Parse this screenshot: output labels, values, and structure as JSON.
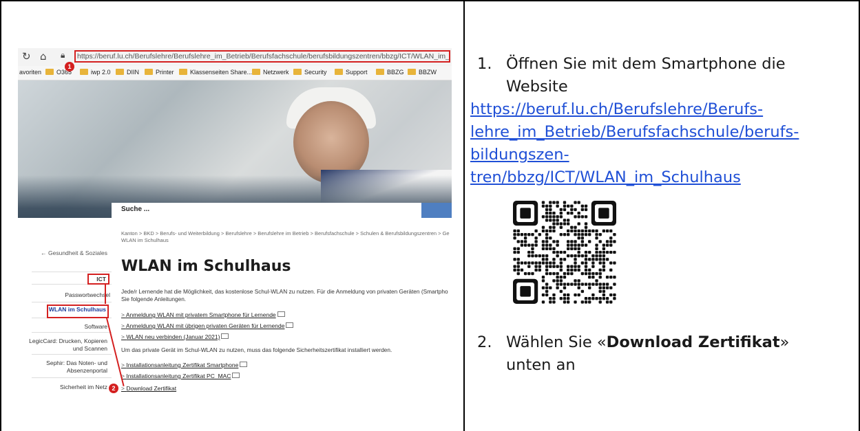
{
  "browser": {
    "reload_icon": "reload-icon",
    "home_icon": "home-icon",
    "url": "https://beruf.lu.ch/Berufslehre/Berufslehre_im_Betrieb/Berufsfachschule/berufsbildungszentren/bbzg/ICT/WLAN_im_Schulhaus"
  },
  "favorites": [
    "avoriten",
    "O365",
    "iwp 2.0",
    "DIIN",
    "Printer",
    "Klassenseiten Share...",
    "Netzwerk",
    "Security",
    "Support",
    "BBZG",
    "BBZW"
  ],
  "site": {
    "search_placeholder": "Suche ...",
    "breadcrumb": "Kanton  >  BKD  >  Berufs- und Weiterbildung  >  Berufslehre  >  Berufslehre im Betrieb  >  Berufsfachschule  >  Schulen & Berufsbildungszentren  >  Ge WLAN im Schulhaus",
    "back_link": "←  Gesundheit & Soziales",
    "nav_section": "ICT",
    "nav_items": [
      "Passwortwechsel",
      "WLAN im Schulhaus",
      "Software",
      "LegicCard: Drucken, Kopieren und Scannen",
      "Sephir: Das Noten- und Absenzenportal",
      "Sicherheit im Netz"
    ],
    "title": "WLAN im Schulhaus",
    "intro": "Jede/r Lernende hat die Möglichkeit, das kostenlose Schul-WLAN zu nutzen. Für die Anmeldung von privaten Geräten (Smartpho Sie folgende Anleitungen.",
    "links": [
      "Anmeldung WLAN mit privatem Smartphone für Lernende",
      "Anmeldung WLAN mit übrigen privaten Geräten für Lernende",
      "WLAN neu verbinden (Januar 2021)"
    ],
    "cert_text": "Um das private Gerät im Schul-WLAN zu nutzen, muss das folgende Sicherheitszertifikat installiert werden.",
    "cert_links": [
      "Installationsanleitung Zertifikat Smartphone",
      "Installationsanleitung Zertifikat PC_MAC",
      "Download Zertifikat"
    ],
    "badge_1": "1",
    "badge_2": "2"
  },
  "instructions": {
    "step1_num": "1.",
    "step1_text_a": "Öffnen Sie mit dem Smartphone die",
    "step1_text_b": "Website",
    "link_lines": [
      "https://beruf.lu.ch/Berufslehre/Berufs-",
      "lehre_im_Betrieb/Berufsfachschule/berufs-",
      "bildungszen-",
      "tren/bbzg/ICT/WLAN_im_Schulhaus"
    ],
    "step2_num": "2.",
    "step2_pre": "Wählen Sie «",
    "step2_bold": "Download Zertifikat",
    "step2_post": "»",
    "step2_line2": "unten an"
  },
  "colors": {
    "link": "#1f4fd6",
    "highlight_red": "#d42020",
    "search_button": "#4f7fc1"
  }
}
